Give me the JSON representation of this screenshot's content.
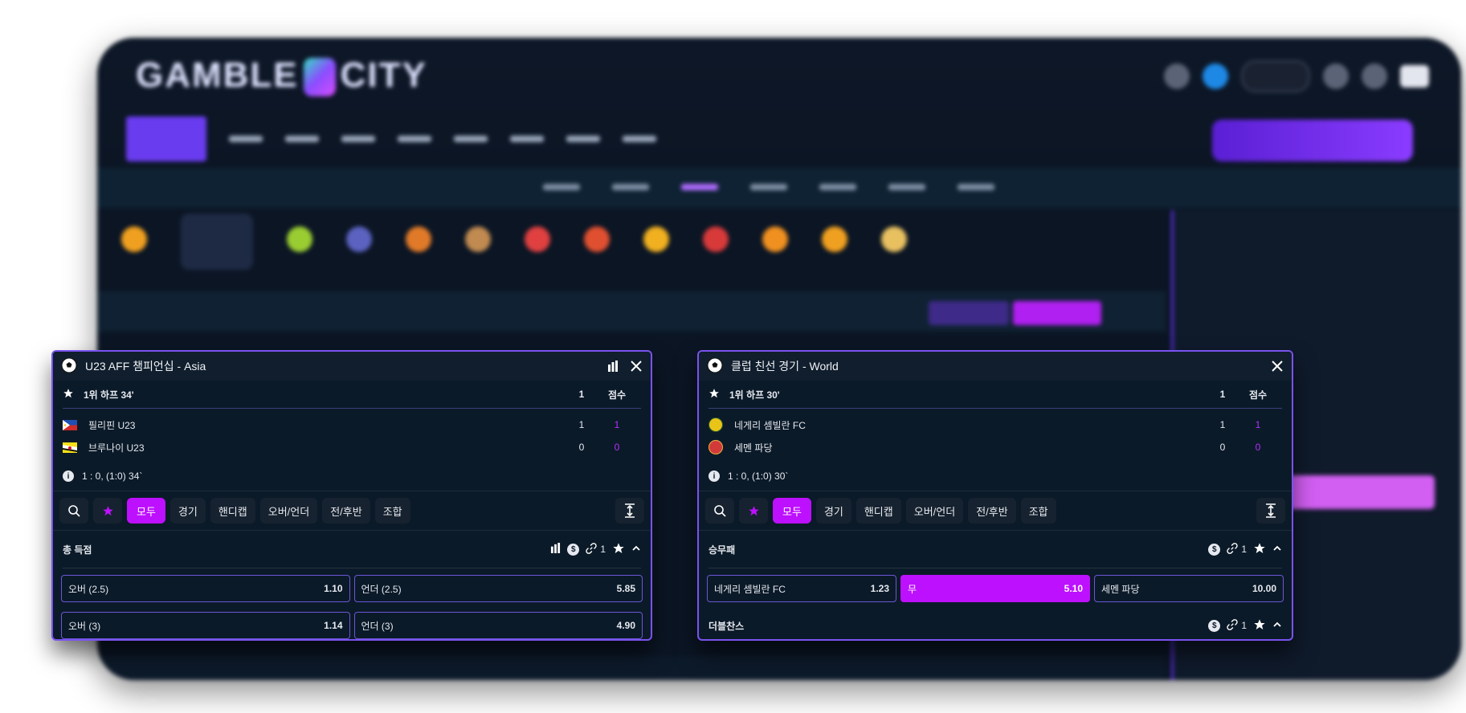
{
  "background": {
    "brand_logo": "GAMBLE CITY"
  },
  "widgets": [
    {
      "league_title": "U23 AFF 챔피언십 - Asia",
      "status_label": "1위 하프 34'",
      "col_period": "1",
      "col_score": "점수",
      "teams": [
        {
          "name": "필리핀 U23",
          "period": "1",
          "score": "1"
        },
        {
          "name": "브루나이 U23",
          "period": "0",
          "score": "0"
        }
      ],
      "match_info": "1 : 0, (1:0) 34`",
      "tabs": [
        "모두",
        "경기",
        "핸디캡",
        "오버/언더",
        "전/후반",
        "조합"
      ],
      "sections": [
        {
          "name": "총 득점",
          "link_count": "1",
          "rows": [
            [
              {
                "label": "오버 (2.5)",
                "odd": "1.10"
              },
              {
                "label": "언더 (2.5)",
                "odd": "5.85"
              }
            ],
            [
              {
                "label": "오버 (3)",
                "odd": "1.14"
              },
              {
                "label": "언더 (3)",
                "odd": "4.90"
              }
            ]
          ]
        }
      ]
    },
    {
      "league_title": "클럽 친선 경기 - World",
      "status_label": "1위 하프 30'",
      "col_period": "1",
      "col_score": "점수",
      "teams": [
        {
          "name": "네게리 셈빌란 FC",
          "period": "1",
          "score": "1"
        },
        {
          "name": "세멘 파당",
          "period": "0",
          "score": "0"
        }
      ],
      "match_info": "1 : 0, (1:0) 30`",
      "tabs": [
        "모두",
        "경기",
        "핸디캡",
        "오버/언더",
        "전/후반",
        "조합"
      ],
      "sections": [
        {
          "name": "승무패",
          "link_count": "1",
          "rows": [
            [
              {
                "label": "네게리 셈빌란 FC",
                "odd": "1.23"
              },
              {
                "label": "무",
                "odd": "5.10"
              },
              {
                "label": "세멘 파당",
                "odd": "10.00"
              }
            ]
          ]
        },
        {
          "name": "더블찬스",
          "link_count": "1"
        }
      ]
    }
  ],
  "colors": {
    "accent": "#bd10ff",
    "border": "#7a53f0",
    "panel": "#0b1a28"
  }
}
